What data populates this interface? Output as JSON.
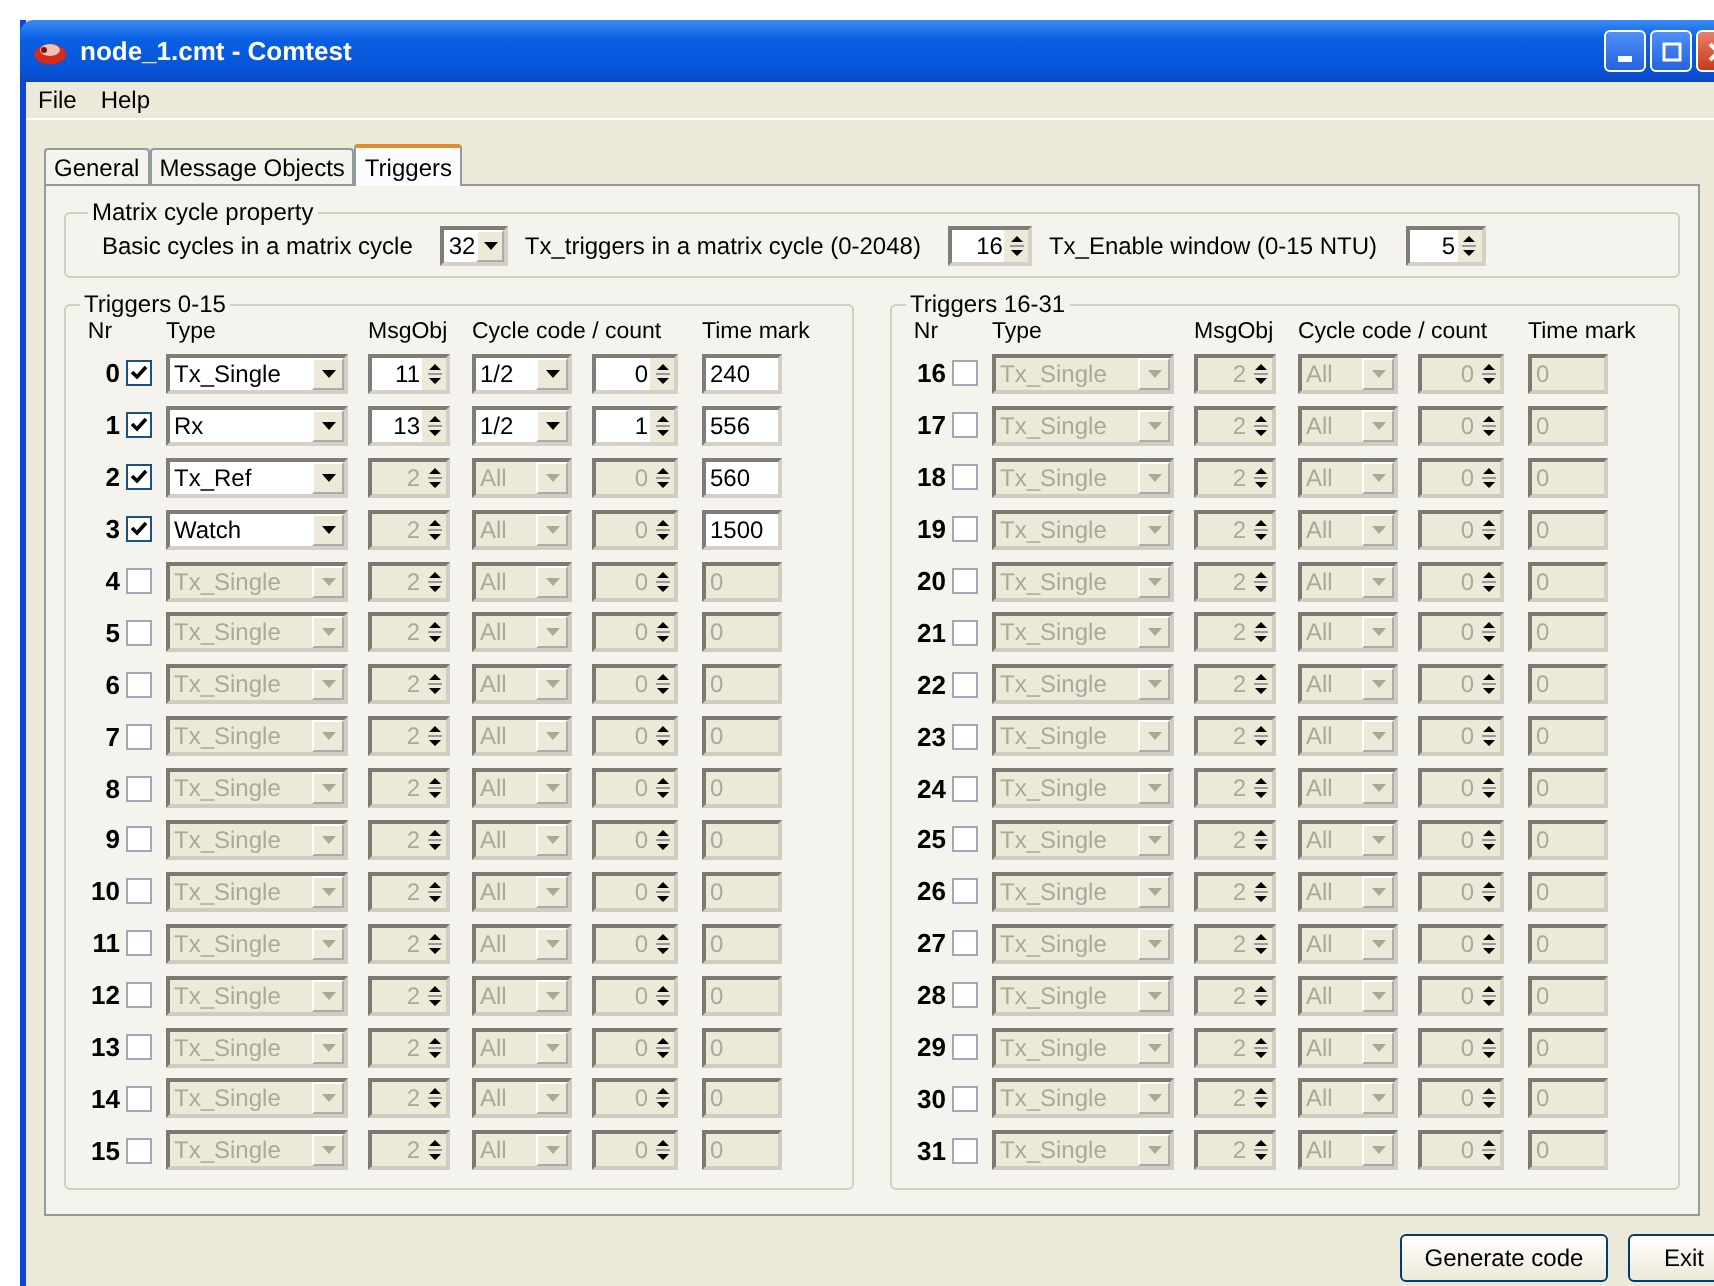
{
  "window": {
    "title": "node_1.cmt - Comtest"
  },
  "menu": [
    "File",
    "Help"
  ],
  "tabs": [
    {
      "label": "General",
      "selected": false
    },
    {
      "label": "Message Objects",
      "selected": false
    },
    {
      "label": "Triggers",
      "selected": true
    }
  ],
  "matrix": {
    "title": "Matrix cycle property",
    "basic_label": "Basic cycles in a matrix cycle",
    "basic_value": "32",
    "tx_label": "Tx_triggers in a matrix cycle (0-2048)",
    "tx_value": "16",
    "enable_label": "Tx_Enable window (0-15 NTU)",
    "enable_value": "5"
  },
  "groups": [
    {
      "title": "Triggers 0-15",
      "headers": [
        "Nr",
        "Type",
        "MsgObj",
        "Cycle code / count",
        "Time mark"
      ],
      "rows": [
        {
          "nr": "0",
          "checked": true,
          "params_disabled": false,
          "type": "Tx_Single",
          "msgobj": "11",
          "cycle_code": "1/2",
          "count": "0",
          "time_mark": "240"
        },
        {
          "nr": "1",
          "checked": true,
          "params_disabled": false,
          "type": "Rx",
          "msgobj": "13",
          "cycle_code": "1/2",
          "count": "1",
          "time_mark": "556"
        },
        {
          "nr": "2",
          "checked": true,
          "params_disabled": true,
          "type": "Tx_Ref",
          "msgobj": "2",
          "cycle_code": "All",
          "count": "0",
          "time_mark": "560"
        },
        {
          "nr": "3",
          "checked": true,
          "params_disabled": true,
          "type": "Watch",
          "msgobj": "2",
          "cycle_code": "All",
          "count": "0",
          "time_mark": "1500"
        },
        {
          "nr": "4",
          "checked": false,
          "params_disabled": true,
          "type": "Tx_Single",
          "msgobj": "2",
          "cycle_code": "All",
          "count": "0",
          "time_mark": "0"
        },
        {
          "nr": "5",
          "checked": false,
          "params_disabled": true,
          "type": "Tx_Single",
          "msgobj": "2",
          "cycle_code": "All",
          "count": "0",
          "time_mark": "0"
        },
        {
          "nr": "6",
          "checked": false,
          "params_disabled": true,
          "type": "Tx_Single",
          "msgobj": "2",
          "cycle_code": "All",
          "count": "0",
          "time_mark": "0"
        },
        {
          "nr": "7",
          "checked": false,
          "params_disabled": true,
          "type": "Tx_Single",
          "msgobj": "2",
          "cycle_code": "All",
          "count": "0",
          "time_mark": "0"
        },
        {
          "nr": "8",
          "checked": false,
          "params_disabled": true,
          "type": "Tx_Single",
          "msgobj": "2",
          "cycle_code": "All",
          "count": "0",
          "time_mark": "0"
        },
        {
          "nr": "9",
          "checked": false,
          "params_disabled": true,
          "type": "Tx_Single",
          "msgobj": "2",
          "cycle_code": "All",
          "count": "0",
          "time_mark": "0"
        },
        {
          "nr": "10",
          "checked": false,
          "params_disabled": true,
          "type": "Tx_Single",
          "msgobj": "2",
          "cycle_code": "All",
          "count": "0",
          "time_mark": "0"
        },
        {
          "nr": "11",
          "checked": false,
          "params_disabled": true,
          "type": "Tx_Single",
          "msgobj": "2",
          "cycle_code": "All",
          "count": "0",
          "time_mark": "0"
        },
        {
          "nr": "12",
          "checked": false,
          "params_disabled": true,
          "type": "Tx_Single",
          "msgobj": "2",
          "cycle_code": "All",
          "count": "0",
          "time_mark": "0"
        },
        {
          "nr": "13",
          "checked": false,
          "params_disabled": true,
          "type": "Tx_Single",
          "msgobj": "2",
          "cycle_code": "All",
          "count": "0",
          "time_mark": "0"
        },
        {
          "nr": "14",
          "checked": false,
          "params_disabled": true,
          "type": "Tx_Single",
          "msgobj": "2",
          "cycle_code": "All",
          "count": "0",
          "time_mark": "0"
        },
        {
          "nr": "15",
          "checked": false,
          "params_disabled": true,
          "type": "Tx_Single",
          "msgobj": "2",
          "cycle_code": "All",
          "count": "0",
          "time_mark": "0"
        }
      ]
    },
    {
      "title": "Triggers 16-31",
      "headers": [
        "Nr",
        "Type",
        "MsgObj",
        "Cycle code / count",
        "Time mark"
      ],
      "rows": [
        {
          "nr": "16",
          "checked": false,
          "params_disabled": true,
          "type": "Tx_Single",
          "msgobj": "2",
          "cycle_code": "All",
          "count": "0",
          "time_mark": "0"
        },
        {
          "nr": "17",
          "checked": false,
          "params_disabled": true,
          "type": "Tx_Single",
          "msgobj": "2",
          "cycle_code": "All",
          "count": "0",
          "time_mark": "0"
        },
        {
          "nr": "18",
          "checked": false,
          "params_disabled": true,
          "type": "Tx_Single",
          "msgobj": "2",
          "cycle_code": "All",
          "count": "0",
          "time_mark": "0"
        },
        {
          "nr": "19",
          "checked": false,
          "params_disabled": true,
          "type": "Tx_Single",
          "msgobj": "2",
          "cycle_code": "All",
          "count": "0",
          "time_mark": "0"
        },
        {
          "nr": "20",
          "checked": false,
          "params_disabled": true,
          "type": "Tx_Single",
          "msgobj": "2",
          "cycle_code": "All",
          "count": "0",
          "time_mark": "0"
        },
        {
          "nr": "21",
          "checked": false,
          "params_disabled": true,
          "type": "Tx_Single",
          "msgobj": "2",
          "cycle_code": "All",
          "count": "0",
          "time_mark": "0"
        },
        {
          "nr": "22",
          "checked": false,
          "params_disabled": true,
          "type": "Tx_Single",
          "msgobj": "2",
          "cycle_code": "All",
          "count": "0",
          "time_mark": "0"
        },
        {
          "nr": "23",
          "checked": false,
          "params_disabled": true,
          "type": "Tx_Single",
          "msgobj": "2",
          "cycle_code": "All",
          "count": "0",
          "time_mark": "0"
        },
        {
          "nr": "24",
          "checked": false,
          "params_disabled": true,
          "type": "Tx_Single",
          "msgobj": "2",
          "cycle_code": "All",
          "count": "0",
          "time_mark": "0"
        },
        {
          "nr": "25",
          "checked": false,
          "params_disabled": true,
          "type": "Tx_Single",
          "msgobj": "2",
          "cycle_code": "All",
          "count": "0",
          "time_mark": "0"
        },
        {
          "nr": "26",
          "checked": false,
          "params_disabled": true,
          "type": "Tx_Single",
          "msgobj": "2",
          "cycle_code": "All",
          "count": "0",
          "time_mark": "0"
        },
        {
          "nr": "27",
          "checked": false,
          "params_disabled": true,
          "type": "Tx_Single",
          "msgobj": "2",
          "cycle_code": "All",
          "count": "0",
          "time_mark": "0"
        },
        {
          "nr": "28",
          "checked": false,
          "params_disabled": true,
          "type": "Tx_Single",
          "msgobj": "2",
          "cycle_code": "All",
          "count": "0",
          "time_mark": "0"
        },
        {
          "nr": "29",
          "checked": false,
          "params_disabled": true,
          "type": "Tx_Single",
          "msgobj": "2",
          "cycle_code": "All",
          "count": "0",
          "time_mark": "0"
        },
        {
          "nr": "30",
          "checked": false,
          "params_disabled": true,
          "type": "Tx_Single",
          "msgobj": "2",
          "cycle_code": "All",
          "count": "0",
          "time_mark": "0"
        },
        {
          "nr": "31",
          "checked": false,
          "params_disabled": true,
          "type": "Tx_Single",
          "msgobj": "2",
          "cycle_code": "All",
          "count": "0",
          "time_mark": "0"
        }
      ]
    }
  ],
  "buttons": [
    "Generate code",
    "Exit"
  ]
}
